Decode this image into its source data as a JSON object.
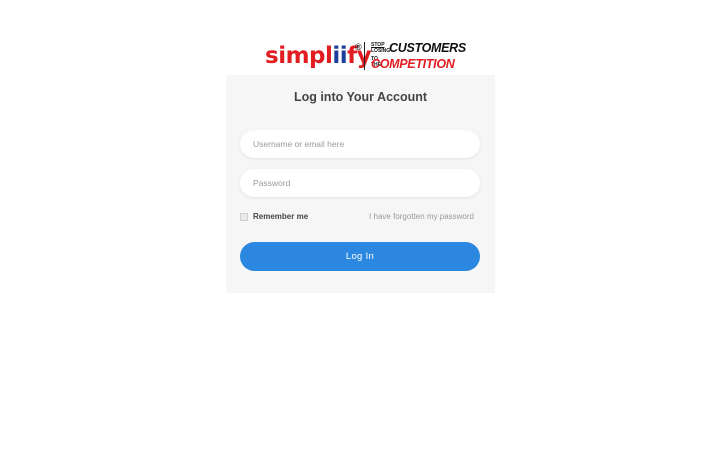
{
  "logo": {
    "word_part1": "simpl",
    "word_part2": "ii",
    "word_part3": "fy",
    "registered": "®",
    "tagline_stop": "STOP",
    "tagline_losing": "LOSING",
    "tagline_customers": "CUSTOMERS",
    "tagline_to_the": "TO THE",
    "tagline_competition": "COMPETITION",
    "colors": {
      "red": "#e11d22",
      "blue": "#1d3f9c"
    }
  },
  "login_form": {
    "title": "Log into Your Account",
    "username_placeholder": "Username or email here",
    "username_value": "",
    "password_placeholder": "Password",
    "password_value": "",
    "remember_label": "Remember me",
    "remember_checked": false,
    "forgot_link": "I have forgotten my password",
    "submit_label": "Log In",
    "accent_color": "#2b87e0"
  }
}
